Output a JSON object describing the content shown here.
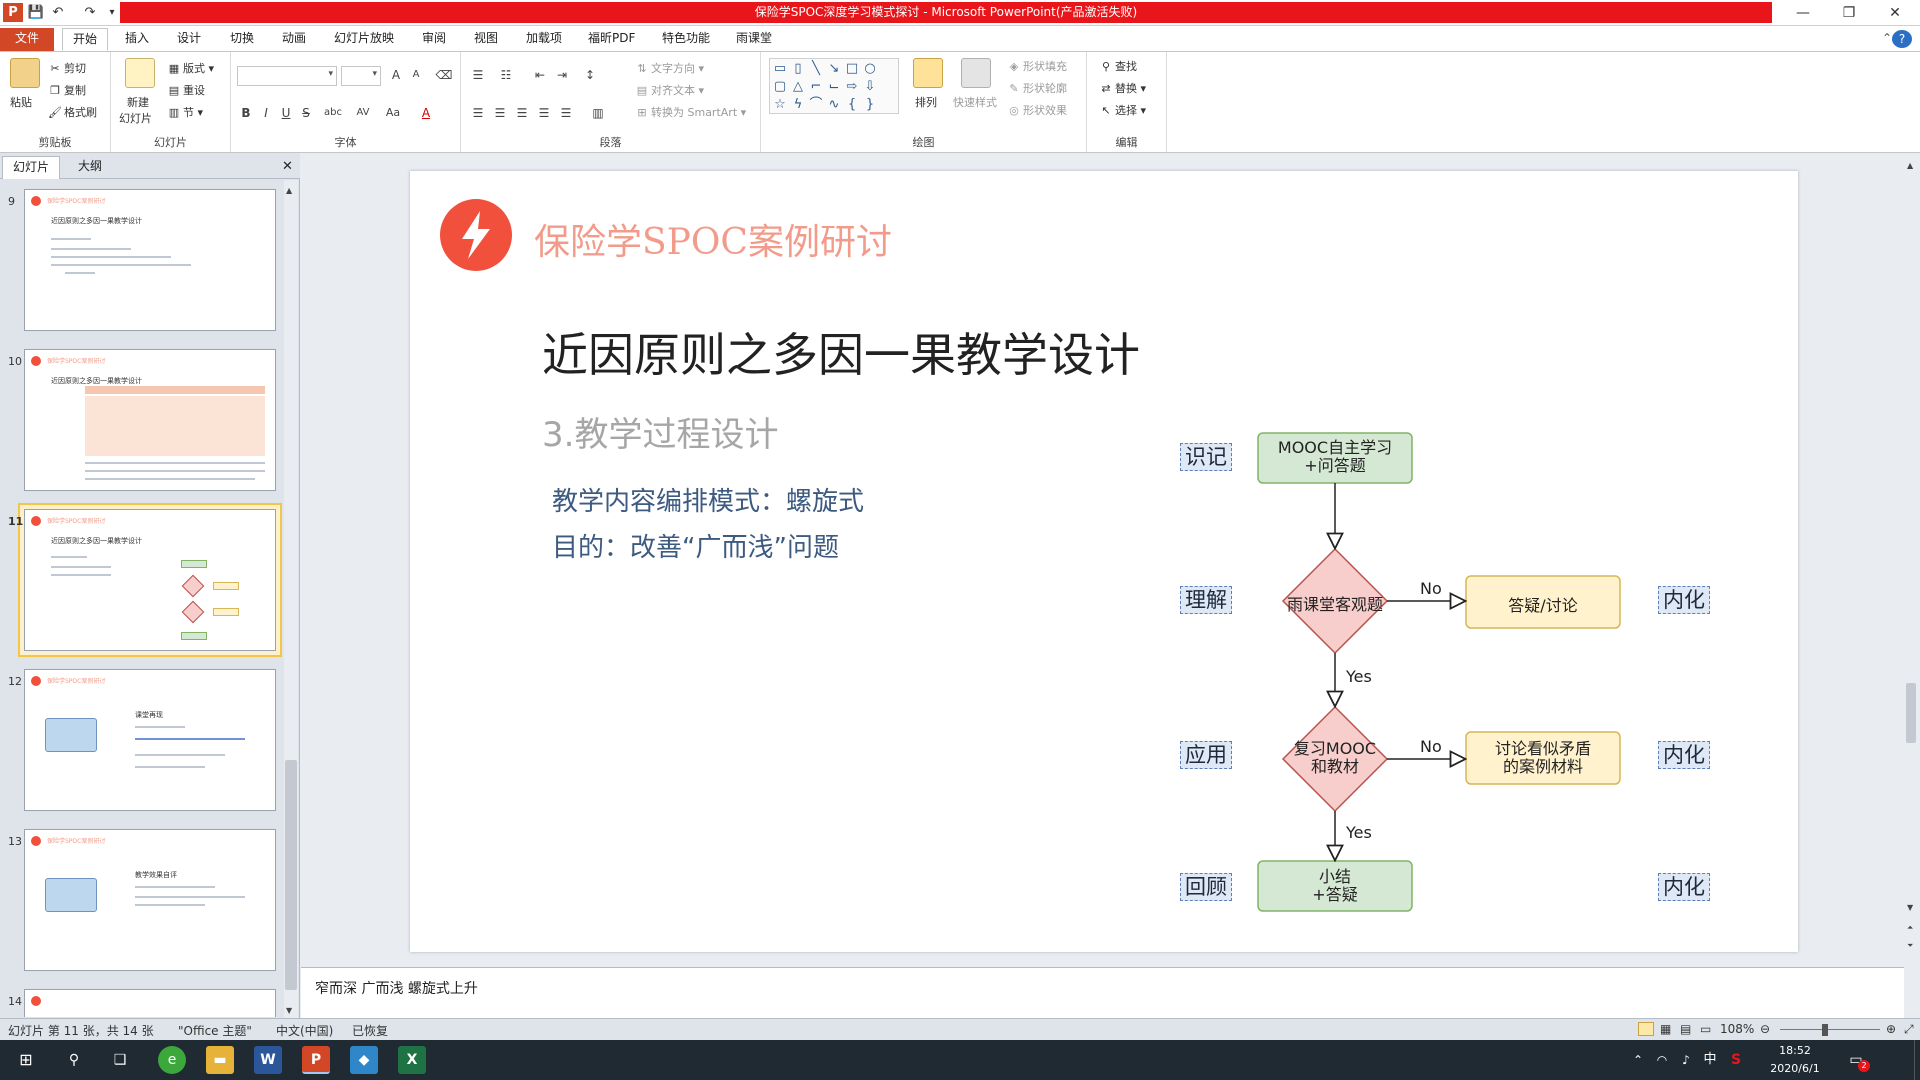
{
  "window": {
    "title": "保险学SPOC深度学习模式探讨 - Microsoft PowerPoint(产品激活失败)",
    "controls": {
      "minimize": "—",
      "restore": "❐",
      "close": "✕"
    }
  },
  "quick_access": {
    "save": "💾",
    "undo": "↶",
    "redo": "↷"
  },
  "menu": {
    "file": "文件",
    "tabs": [
      "开始",
      "插入",
      "设计",
      "切换",
      "动画",
      "幻灯片放映",
      "审阅",
      "视图",
      "加载项",
      "福昕PDF",
      "特色功能",
      "雨课堂"
    ],
    "help": "?"
  },
  "ribbon": {
    "clipboard": {
      "paste": "粘贴",
      "cut": "剪切",
      "copy": "复制",
      "format_painter": "格式刷",
      "label": "剪贴板"
    },
    "slides": {
      "new_slide_1": "新建",
      "new_slide_2": "幻灯片",
      "layout": "版式",
      "reset": "重设",
      "section": "节",
      "label": "幻灯片"
    },
    "font": {
      "label": "字体",
      "bold": "B",
      "italic": "I",
      "underline": "U",
      "strike": "S",
      "shadow": "abc",
      "spacing": "AV",
      "case": "Aa",
      "color": "A",
      "grow": "A",
      "shrink": "A"
    },
    "paragraph": {
      "text_direction": "文字方向",
      "align_text": "对齐文本",
      "smartart": "转换为 SmartArt",
      "label": "段落"
    },
    "drawing": {
      "arrange": "排列",
      "quick_styles": "快速样式",
      "shape_fill": "形状填充",
      "shape_outline": "形状轮廓",
      "shape_effects": "形状效果",
      "label": "绘图"
    },
    "editing": {
      "find": "查找",
      "replace": "替换",
      "select": "选择",
      "label": "编辑"
    }
  },
  "left_pane": {
    "tabs": [
      "幻灯片",
      "大纲"
    ],
    "close": "✕",
    "thumbs": [
      {
        "num": "9",
        "head": "保险学SPOC案例研讨",
        "title": "近因原则之多因一果教学设计"
      },
      {
        "num": "10",
        "head": "保险学SPOC案例研讨",
        "title": "近因原则之多因一果教学设计"
      },
      {
        "num": "11",
        "head": "保险学SPOC案例研讨",
        "title": "近因原则之多因一果教学设计"
      },
      {
        "num": "12",
        "head": "保险学SPOC案例研讨",
        "title": "课堂再现"
      },
      {
        "num": "13",
        "head": "保险学SPOC案例研讨",
        "title": "教学效果自评"
      },
      {
        "num": "14",
        "head": "",
        "title": ""
      }
    ]
  },
  "slide": {
    "header": "保险学SPOC案例研讨",
    "title": "近因原则之多因一果教学设计",
    "subtitle": "3.教学过程设计",
    "body": [
      "教学内容编排模式：螺旋式",
      "目的：改善“广而浅”问题"
    ],
    "flowchart": {
      "left_labels": [
        "识记",
        "理解",
        "应用",
        "回顾"
      ],
      "right_labels": [
        "内化",
        "内化",
        "内化"
      ],
      "nodes": {
        "start": [
          "MOOC自主学习",
          "+问答题"
        ],
        "decision1": "雨课堂客观题",
        "branch1": "答疑/讨论",
        "decision2": [
          "复习MOOC",
          "和教材"
        ],
        "branch2": [
          "讨论看似矛盾",
          "的案例材料"
        ],
        "end": [
          "小结",
          "+答疑"
        ]
      },
      "edge_labels": {
        "no1": "No",
        "yes1": "Yes",
        "no2": "No",
        "yes2": "Yes"
      }
    }
  },
  "notes": {
    "text": "窄而深  广而浅  螺旋式上升"
  },
  "status": {
    "slide_info": "幻灯片 第 11 张，共 14 张",
    "theme": "\"Office 主题\"",
    "language": "中文(中国)",
    "recovered": "已恢复",
    "zoom": "108%"
  },
  "taskbar": {
    "time": "18:52",
    "date": "2020/6/1",
    "ime": "中",
    "notif": "2"
  },
  "colors": {
    "title_red": "#e8161b",
    "file_tab": "#d24726",
    "slide_header": "#f0503c",
    "green_node": "#d5e8d4",
    "red_node": "#f8cecc",
    "yellow_node": "#fff2cc",
    "body_blue": "#3d5a80"
  }
}
